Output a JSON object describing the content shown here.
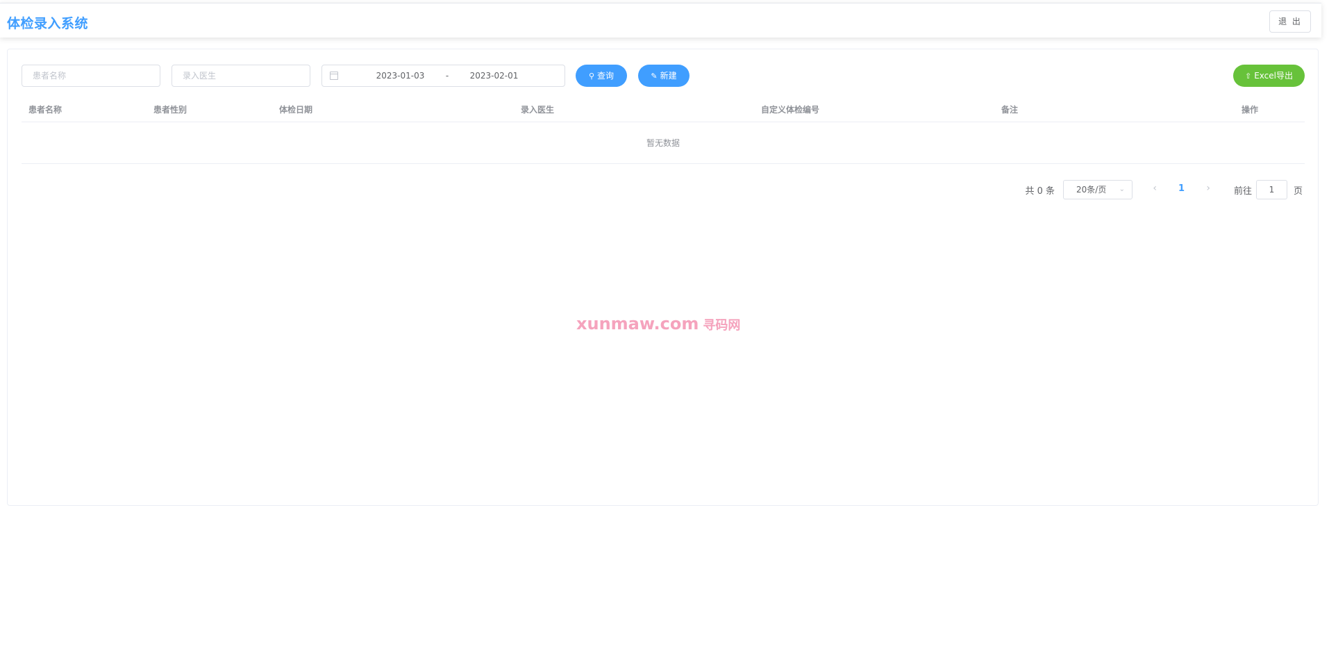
{
  "header": {
    "title": "体检录入系统",
    "logout_label": "退 出"
  },
  "filters": {
    "patient_name_placeholder": "患者名称",
    "doctor_placeholder": "录入医生",
    "date_start": "2023-01-03",
    "date_separator": "-",
    "date_end": "2023-02-01",
    "search_label": "查询",
    "new_label": "新建",
    "export_label": "Excel导出"
  },
  "table": {
    "columns": [
      "患者名称",
      "患者性别",
      "体检日期",
      "录入医生",
      "自定义体检编号",
      "备注",
      "操作"
    ],
    "empty_text": "暂无数据"
  },
  "pagination": {
    "total_text": "共 0 条",
    "page_size": "20条/页",
    "current_page": "1",
    "goto_label": "前往",
    "goto_value": "1",
    "goto_suffix": "页"
  },
  "watermark": {
    "text": "xunmaw.com",
    "text_cn": "寻码网"
  },
  "colors": {
    "accent": "#409eff",
    "export": "#67c23a",
    "watermark": "#f5a3bd"
  }
}
